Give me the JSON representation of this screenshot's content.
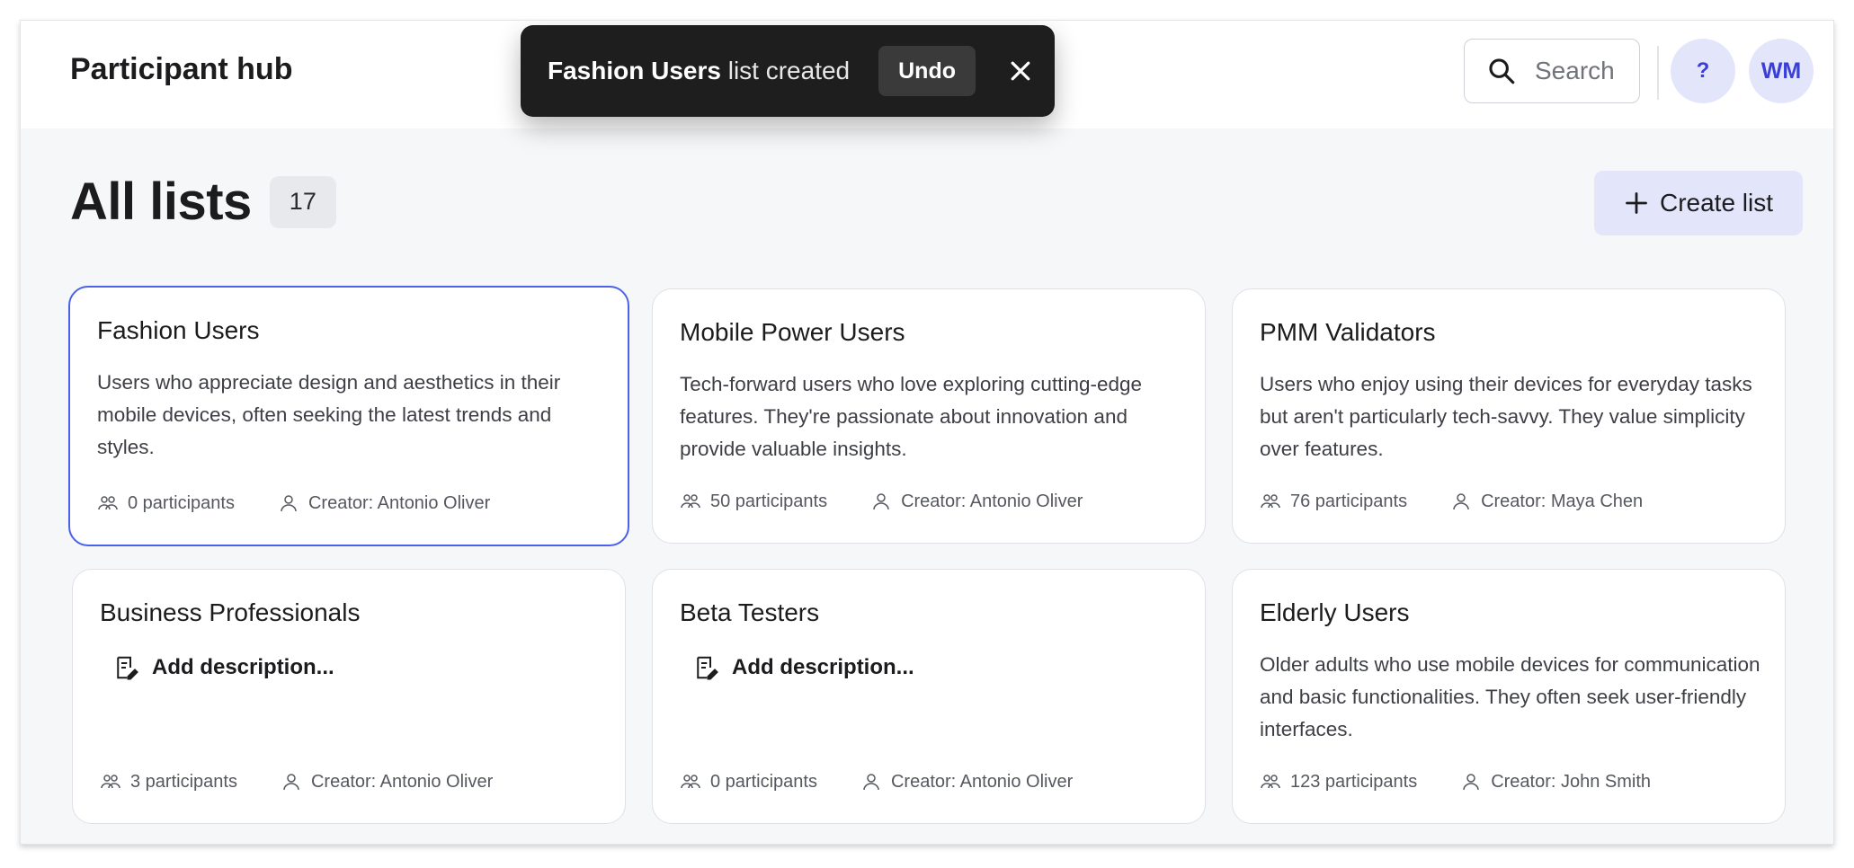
{
  "header": {
    "title": "Participant hub",
    "search_placeholder": "Search",
    "help_label": "?",
    "avatar_initials": "WM"
  },
  "toast": {
    "list_name": "Fashion Users",
    "message": " list created",
    "undo_label": "Undo"
  },
  "main": {
    "heading": "All lists",
    "count": "17",
    "create_label": "Create list"
  },
  "cards": [
    {
      "title": "Fashion Users",
      "description": "Users who appreciate design and aesthetics in their mobile devices, often seeking the latest trends and styles.",
      "participants": "0 participants",
      "creator": "Creator: Antonio Oliver"
    },
    {
      "title": "Mobile Power Users",
      "description": "Tech-forward users who love exploring cutting-edge features. They're passionate about innovation and provide valuable insights.",
      "participants": "50 participants",
      "creator": "Creator: Antonio Oliver"
    },
    {
      "title": "PMM Validators",
      "description": "Users who enjoy using their devices for everyday tasks but aren't particularly tech-savvy. They value simplicity over features.",
      "participants": "76 participants",
      "creator": "Creator: Maya Chen"
    },
    {
      "title": "Business Professionals",
      "add_description": "Add description...",
      "participants": "3 participants",
      "creator": "Creator: Antonio Oliver"
    },
    {
      "title": "Beta Testers",
      "add_description": "Add description...",
      "participants": "0 participants",
      "creator": "Creator: Antonio Oliver"
    },
    {
      "title": "Elderly Users",
      "description": "Older adults who use mobile devices for communication and basic functionalities. They often seek user-friendly interfaces.",
      "participants": "123 participants",
      "creator": "Creator: John Smith"
    }
  ],
  "colors": {
    "accent": "#4a62e8",
    "accent_soft": "#e3e5fb",
    "toast_bg": "#1e1e1e",
    "page_bg": "#f6f7f9"
  },
  "icons": [
    "search-icon",
    "close-icon",
    "plus-icon",
    "group-icon",
    "person-icon",
    "edit-note-icon"
  ]
}
